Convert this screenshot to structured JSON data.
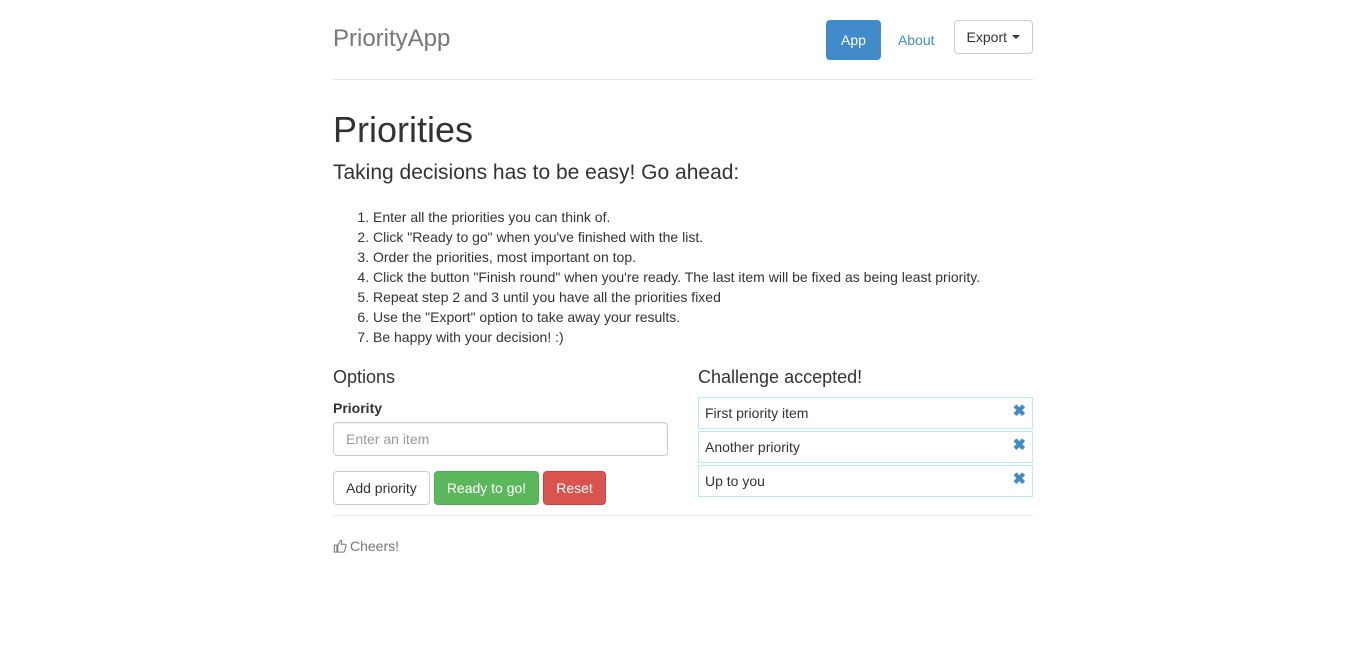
{
  "header": {
    "brand": "PriorityApp",
    "nav": {
      "app_label": "App",
      "about_label": "About",
      "export_label": "Export"
    }
  },
  "main": {
    "title": "Priorities",
    "lead": "Taking decisions has to be easy! Go ahead:",
    "steps": [
      "Enter all the priorities you can think of.",
      "Click \"Ready to go\" when you've finished with the list.",
      "Order the priorities, most important on top.",
      "Click the button \"Finish round\" when you're ready. The last item will be fixed as being least priority.",
      "Repeat step 2 and 3 until you have all the priorities fixed",
      "Use the \"Export\" option to take away your results.",
      "Be happy with your decision! :)"
    ]
  },
  "options": {
    "heading": "Options",
    "priority_label": "Priority",
    "input_placeholder": "Enter an item",
    "input_value": "",
    "add_label": "Add priority",
    "ready_label": "Ready to go!",
    "reset_label": "Reset"
  },
  "challenge": {
    "heading": "Challenge accepted!",
    "items": [
      {
        "label": "First priority item",
        "remove_icon": "✖"
      },
      {
        "label": "Another priority",
        "remove_icon": "✖"
      },
      {
        "label": "Up to you",
        "remove_icon": "✖"
      }
    ]
  },
  "footer": {
    "text": "Cheers!",
    "icon": "thumbs-up-icon"
  },
  "colors": {
    "primary": "#428bca",
    "success": "#5cb85c",
    "danger": "#d9534f",
    "item_border": "#bce8f1"
  }
}
